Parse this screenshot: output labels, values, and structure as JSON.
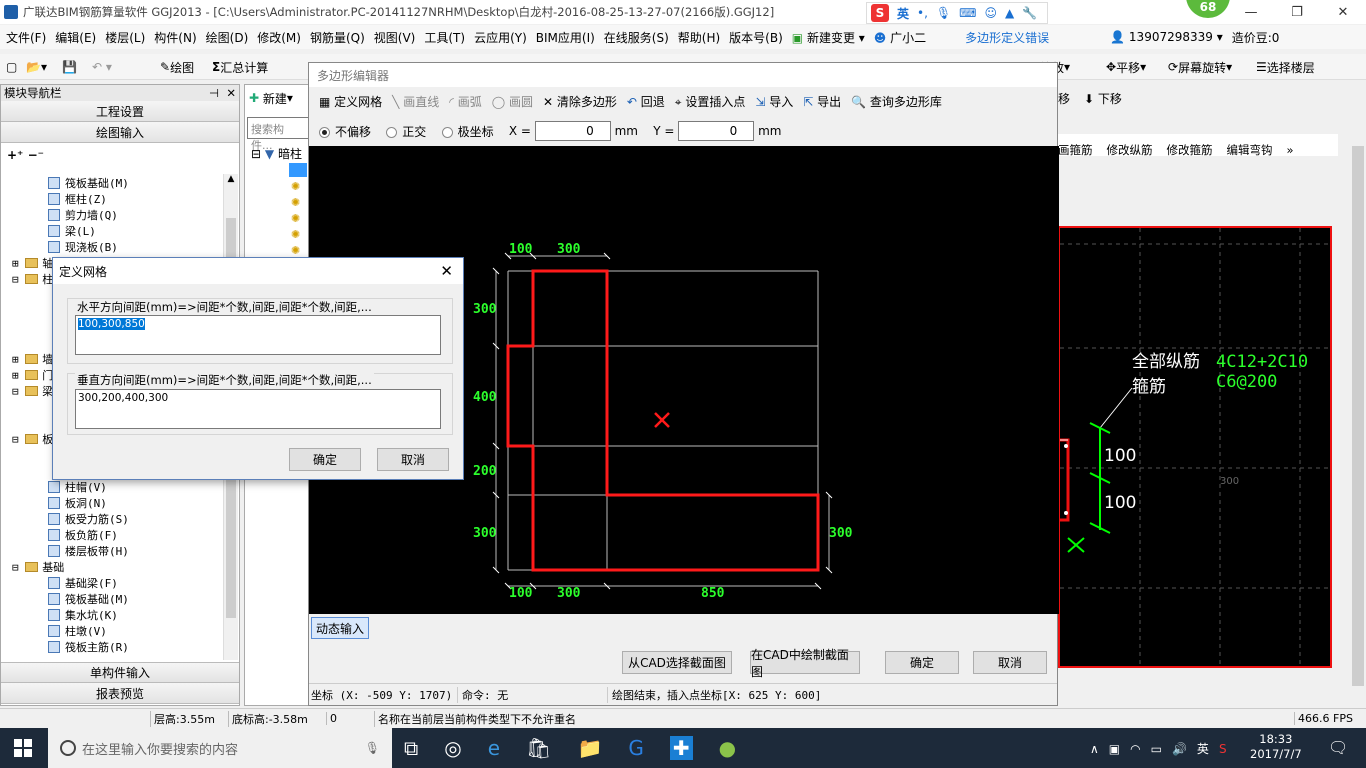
{
  "app": {
    "title": "广联达BIM钢筋算量软件 GGJ2013 - [C:\\Users\\Administrator.PC-20141127NRHM\\Desktop\\白龙村-2016-08-25-13-27-07(2166版).GGJ12]",
    "badge": "68"
  },
  "menu": [
    "文件(F)",
    "编辑(E)",
    "楼层(L)",
    "构件(N)",
    "绘图(D)",
    "修改(M)",
    "钢筋量(Q)",
    "视图(V)",
    "工具(T)",
    "云应用(Y)",
    "BIM应用(I)",
    "在线服务(S)",
    "帮助(H)",
    "版本号(B)",
    "新建变更",
    "广小二",
    "多边形定义错误",
    "13907298339",
    "造价豆:0"
  ],
  "ime_label": "英",
  "toolbar": {
    "draw": "绘图",
    "sum_calc": "汇总计算",
    "zoom": "缩放",
    "pan": "平移",
    "rotate": "屏幕旋转",
    "select_floor": "选择楼层"
  },
  "nav": {
    "title": "模块导航栏",
    "project_settings": "工程设置",
    "draw_input": "绘图输入",
    "single_input": "单构件输入",
    "report_preview": "报表预览",
    "items_top": [
      "筏板基础(M)",
      "框柱(Z)",
      "剪力墙(Q)",
      "梁(L)",
      "现浇板(B)"
    ],
    "items_bottom": [
      "柱帽(V)",
      "板洞(N)",
      "板受力筋(S)",
      "板负筋(F)",
      "楼层板带(H)"
    ],
    "foundation": "基础",
    "foundation_items": [
      "基础梁(F)",
      "筏板基础(M)",
      "集水坑(K)",
      "柱墩(V)",
      "筏板主筋(R)"
    ],
    "partial_folders": [
      "轴",
      "柱",
      "墙",
      "门",
      "梁",
      "板"
    ]
  },
  "component_panel": {
    "new_label": "新建",
    "search_placeholder": "搜索构件...",
    "tree_root": "暗柱"
  },
  "right_panel": {
    "tabs": [
      "画箍筋",
      "修改纵筋",
      "修改箍筋",
      "编辑弯钩"
    ],
    "side_tools": [
      "移",
      "下移"
    ],
    "labels": {
      "all_rebar": "全部纵筋",
      "stirrup": "箍筋",
      "rebar_value": "4C12+2C10",
      "stirrup_value": "C6@200",
      "dim1": "100",
      "dim2": "100",
      "grid_label": "300"
    }
  },
  "poly_editor": {
    "title": "多边形编辑器",
    "tools": [
      "定义网格",
      "画直线",
      "画弧",
      "画圆",
      "清除多边形",
      "回退",
      "设置插入点",
      "导入",
      "导出",
      "查询多边形库"
    ],
    "radios": [
      "不偏移",
      "正交",
      "极坐标"
    ],
    "x_label": "X =",
    "x_value": "0",
    "y_label": "Y =",
    "y_value": "0",
    "unit": "mm",
    "dims": {
      "top": [
        "100",
        "300"
      ],
      "bottom": [
        "100",
        "300",
        "850"
      ],
      "left": [
        "300",
        "400",
        "200",
        "300"
      ],
      "right": "300"
    },
    "dynamic_input": "动态输入",
    "btn_cad_select": "从CAD选择截面图",
    "btn_cad_draw": "在CAD中绘制截面图",
    "btn_ok": "确定",
    "btn_cancel": "取消",
    "status_coord": "坐标 (X: -509 Y: 1707)",
    "status_cmd": "命令: 无",
    "status_msg": "绘图结束，插入点坐标[X: 625 Y: 600]"
  },
  "grid_dialog": {
    "title": "定义网格",
    "h_label": "水平方向间距(mm)=>间距*个数,间距,间距*个数,间距,...",
    "h_value": "100,300,850",
    "v_label": "垂直方向间距(mm)=>间距*个数,间距,间距*个数,间距,...",
    "v_value": "300,200,400,300",
    "ok": "确定",
    "cancel": "取消"
  },
  "status": {
    "floor_height": "层高:3.55m",
    "bottom_height": "底标高:-3.58m",
    "zero": "0",
    "message": "名称在当前层当前构件类型下不允许重名",
    "fps": "466.6 FPS"
  },
  "taskbar": {
    "search_placeholder": "在这里输入你要搜索的内容",
    "ime": "英",
    "time": "18:33",
    "date": "2017/7/7"
  }
}
